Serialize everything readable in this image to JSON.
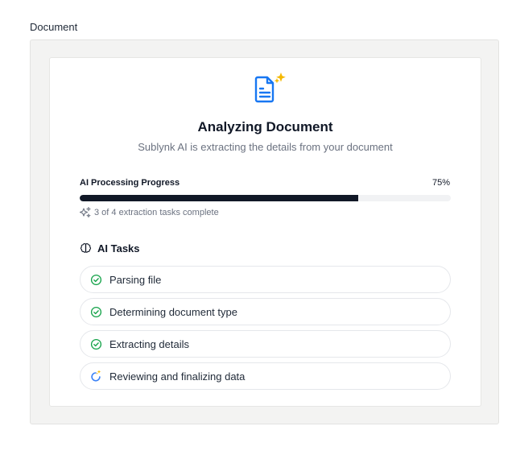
{
  "section": {
    "label": "Document"
  },
  "header": {
    "title": "Analyzing Document",
    "subtitle": "Sublynk AI is extracting the details from your document",
    "icon": "document-sparkle-icon"
  },
  "progress": {
    "label": "AI Processing Progress",
    "percent_text": "75%",
    "value": 0.75,
    "status": "3 of 4 extraction tasks complete"
  },
  "tasks": {
    "heading": "AI Tasks",
    "items": [
      {
        "label": "Parsing file",
        "status": "complete"
      },
      {
        "label": "Determining document type",
        "status": "complete"
      },
      {
        "label": "Extracting details",
        "status": "complete"
      },
      {
        "label": "Reviewing and finalizing data",
        "status": "in-progress"
      }
    ]
  },
  "colors": {
    "accent_blue": "#1877f2",
    "check_green": "#16a34a",
    "sparkle_yellow": "#f5b800",
    "progress_fill": "#111827",
    "spinner_blue": "#3b82f6"
  }
}
